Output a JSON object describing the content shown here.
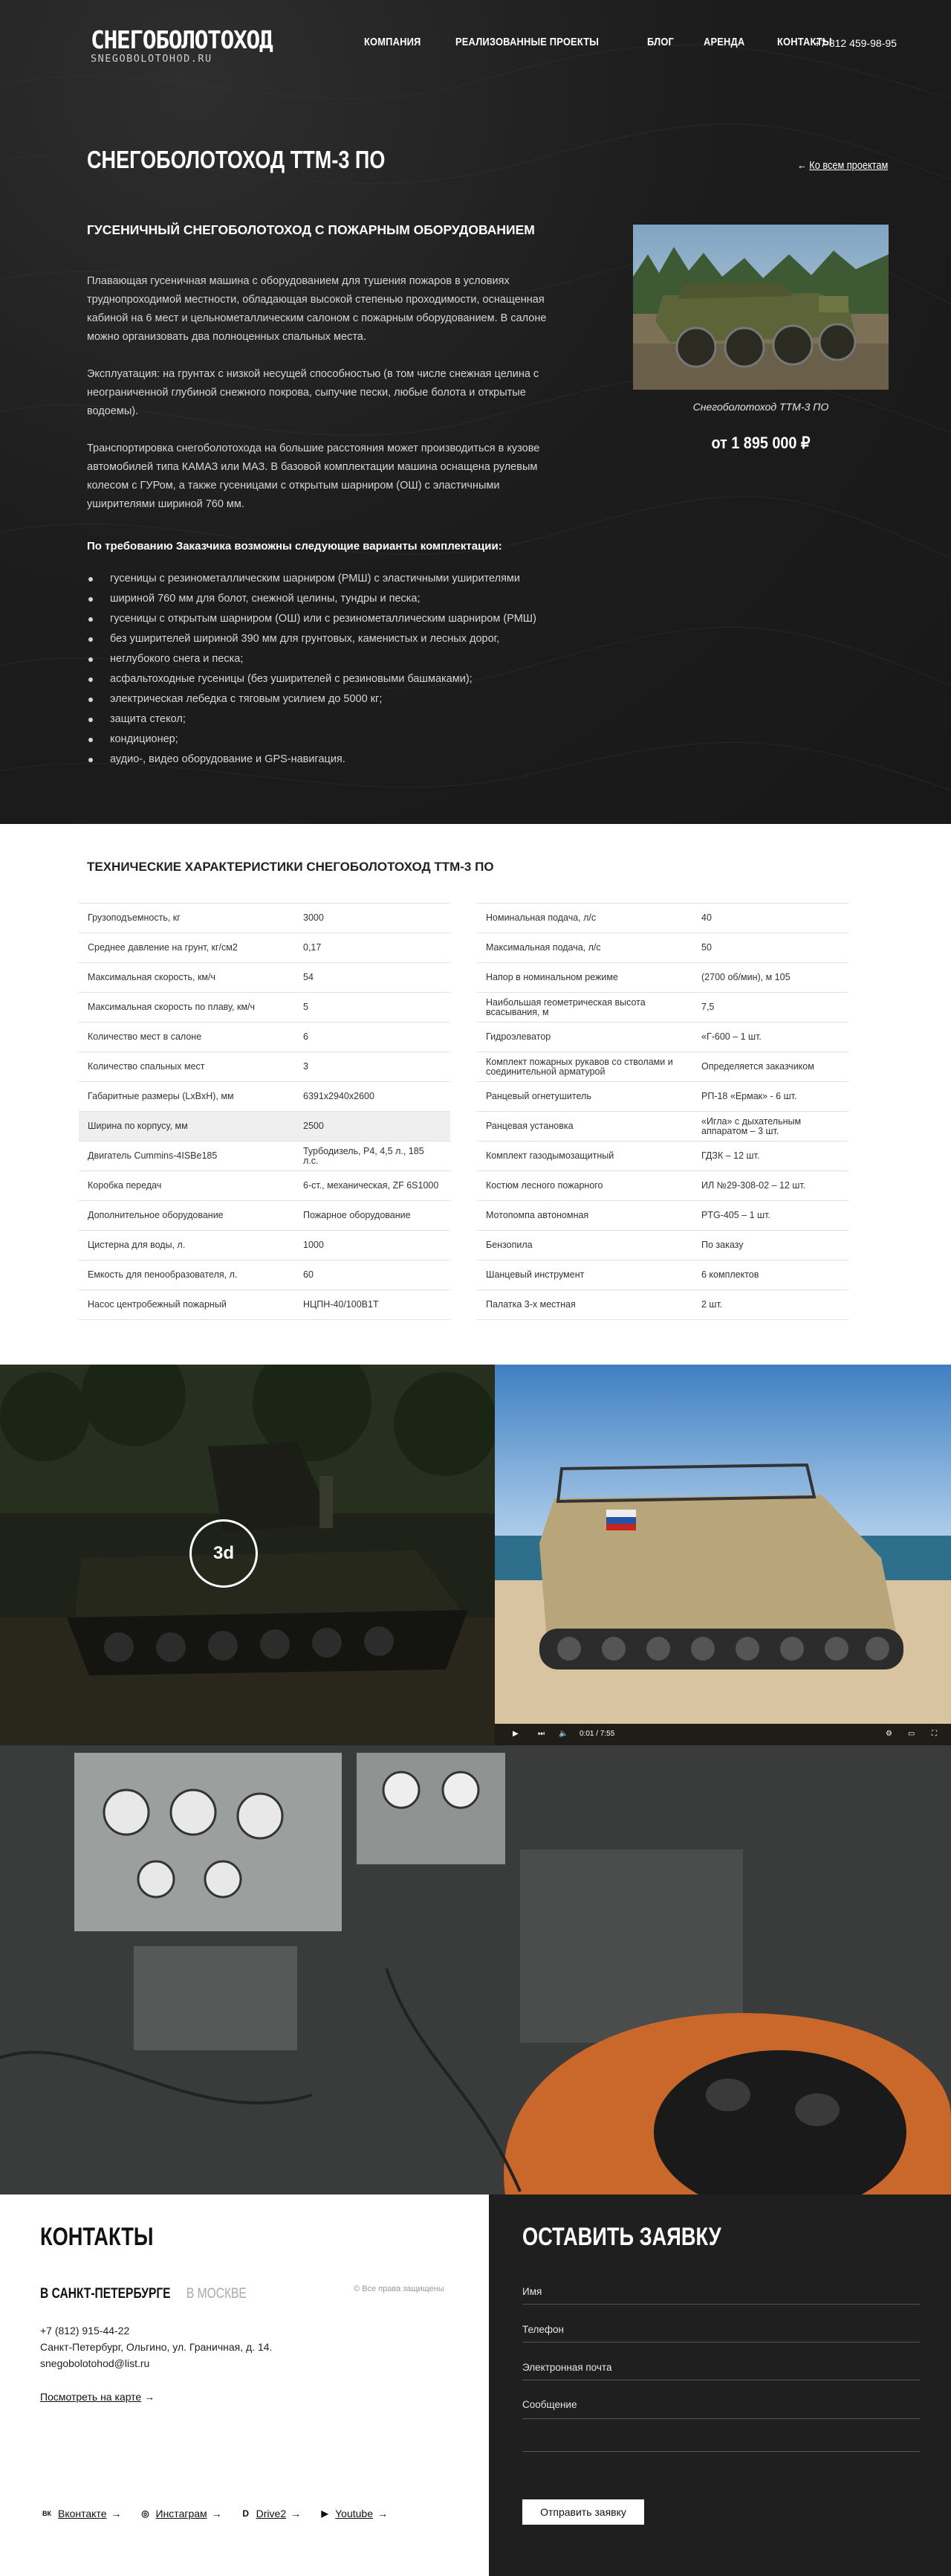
{
  "header": {
    "logo_main": "СНЕГОБОЛОТОХОД",
    "logo_sub": "SNEGOBOLOTOHOD.RU",
    "nav": [
      "КОМПАНИЯ",
      "РЕАЛИЗОВАННЫЕ ПРОЕКТЫ",
      "БЛОГ",
      "АРЕНДА",
      "КОНТАКТЫ"
    ],
    "phone": "+7 812 459-98-95"
  },
  "product": {
    "title": "СНЕГОБОЛОТОХОД ТТМ-3 ПО",
    "back_link": "Ко всем проектам",
    "back_arrow": "←",
    "subtitle": "ГУСЕНИЧНЫЙ СНЕГОБОЛОТОХОД С ПОЖАРНЫМ ОБОРУДОВАНИЕМ",
    "paragraphs": [
      "Плавающая гусеничная машина с оборудованием для тушения пожаров в условиях труднопроходимой местности, обладающая высокой степенью проходимости, оснащенная кабиной на 6 мест и цельнометаллическим салоном с пожарным оборудованием. В салоне можно организовать два полноценных спальных места.",
      "Эксплуатация: на грунтах с низкой несущей способностью (в том числе снежная целина с неограниченной глубиной снежного покрова, сыпучие пески, любые болота и открытые водоемы).",
      "Транспортировка снегоболотохода на большие расстояния может производиться в кузове автомобилей типа КАМАЗ или МАЗ. В базовой комплектации машина оснащена рулевым колесом с ГУРом, а также гусеницами с открытым шарниром (ОШ) с эластичными уширителями шириной 760 мм."
    ],
    "options_title": "По требованию Заказчика возможны следующие варианты комплектации:",
    "options": [
      "гусеницы с резинометаллическим шарниром (РМШ) с эластичными уширителями",
      "шириной 760 мм для болот, снежной целины, тундры и песка;",
      "гусеницы с открытым шарниром (ОШ) или с резинометаллическим шарниром (РМШ)",
      "без уширителей шириной 390 мм для грунтовых, каменистых и лесных дорог,",
      "неглубокого снега и песка;",
      "асфальтоходные гусеницы (без уширителей с резиновыми башмаками);",
      "электрическая лебедка с тяговым усилием до 5000 кг;",
      "защита стекол;",
      "кондиционер;",
      "аудио-, видео оборудование и GPS-навигация."
    ],
    "photo_caption": "Снегоболотоход ТТМ-3 ПО",
    "price": "от 1 895 000 ₽"
  },
  "specs": {
    "title": "ТЕХНИЧЕСКИЕ ХАРАКТЕРИСТИКИ СНЕГОБОЛОТОХОД ТТМ-3 ПО",
    "left": [
      [
        "Грузоподъемность, кг",
        "3000"
      ],
      [
        "Среднее давление на грунт, кг/см2",
        "0,17"
      ],
      [
        "Максимальная скорость, км/ч",
        "54"
      ],
      [
        "Максимальная скорость по плаву, км/ч",
        "5"
      ],
      [
        "Количество мест в салоне",
        "6"
      ],
      [
        "Количество спальных мест",
        "3"
      ],
      [
        "Габаритные размеры (LxBxH), мм",
        "6391х2940х2600"
      ],
      [
        "Ширина по корпусу, мм",
        "2500"
      ],
      [
        "Двигатель Cummins-4ISBe185",
        "Турбодизель, Р4, 4,5 л., 185 л.с."
      ],
      [
        "Коробка передач",
        "6-ст., механическая, ZF 6S1000"
      ],
      [
        "Дополнительное оборудование",
        "Пожарное оборудование"
      ],
      [
        "Цистерна для воды, л.",
        "1000"
      ],
      [
        "Емкость для пенообразователя, л.",
        "60"
      ],
      [
        "Насос центробежный пожарный",
        "НЦПН-40/100В1Т"
      ]
    ],
    "right": [
      [
        "Номинальная подача, л/с",
        "40"
      ],
      [
        "Максимальная подача, л/с",
        "50"
      ],
      [
        "Напор в номинальном режиме",
        "(2700 об/мин), м 105"
      ],
      [
        "Наибольшая геометрическая высота всасывания, м",
        "7,5"
      ],
      [
        "Гидроэлеватор",
        "«Г-600 – 1 шт."
      ],
      [
        "Комплект пожарных рукавов со стволами и соединительной арматурой",
        "Определяется заказчиком"
      ],
      [
        "Ранцевый огнетушитель",
        "РП-18 «Ермак» - 6 шт."
      ],
      [
        "Ранцевая установка",
        "«Игла» с дыхательным аппаратом – 3 шт."
      ],
      [
        "Комплект газодымозащитный",
        "ГДЗК – 12 шт."
      ],
      [
        "Костюм лесного пожарного",
        "ИЛ №29-308-02 – 12 шт."
      ],
      [
        "Мотопомпа автономная",
        "PTG-405 – 1 шт."
      ],
      [
        "Бензопила",
        "По заказу"
      ],
      [
        "Шанцевый инструмент",
        "6 комплектов"
      ],
      [
        "Палатка 3-х местная",
        "2 шт."
      ]
    ]
  },
  "gallery": {
    "badge_3d": "3d",
    "video_time": "0:01 / 7:55"
  },
  "contacts": {
    "title": "КОНТАКТЫ",
    "city_active": "В САНКТ-ПЕТЕРБУРГЕ",
    "city_inactive": "В МОСКВЕ",
    "rights": "© Все права защищены",
    "phone": "+7 (812) 915-44-22",
    "address": "Санкт-Петербург, Ольгино, ул. Граничная, д. 14.",
    "email": "snegobolotohod@list.ru",
    "map_link": "Посмотреть на карте",
    "arrow": "→",
    "socials": [
      {
        "icon": "vk-icon",
        "glyph": "ВК",
        "label": "Вконтакте"
      },
      {
        "icon": "instagram-icon",
        "glyph": "◎",
        "label": "Инстаграм"
      },
      {
        "icon": "drive2-icon",
        "glyph": "D",
        "label": "Drive2"
      },
      {
        "icon": "youtube-icon",
        "glyph": "▶",
        "label": "Youtube"
      }
    ]
  },
  "order_form": {
    "title": "ОСТАВИТЬ ЗАЯВКУ",
    "name_placeholder": "Имя",
    "phone_placeholder": "Телефон",
    "email_placeholder": "Электронная почта",
    "message_placeholder": "Сообщение",
    "submit": "Отправить заявку"
  },
  "colors": {
    "hero_bg": "#1f1f1f",
    "form_bg": "#1f1f1f",
    "text_dark": "#222222",
    "row_highlight": "#efefef"
  }
}
